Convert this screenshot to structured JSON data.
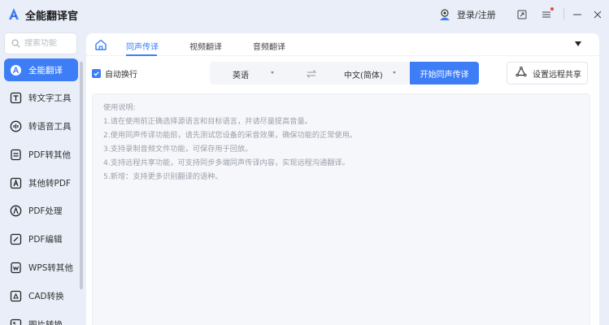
{
  "app": {
    "title": "全能翻译官",
    "login_label": "登录/注册"
  },
  "titlebar_icons": [
    "expand-icon",
    "menu-icon",
    "minimize-icon",
    "close-icon"
  ],
  "sidebar": {
    "search_placeholder": "搜索功能",
    "items": [
      {
        "label": "全能翻译",
        "icon": "translate-icon",
        "active": true
      },
      {
        "label": "转文字工具",
        "icon": "text-tool-icon",
        "active": false
      },
      {
        "label": "转语音工具",
        "icon": "voice-tool-icon",
        "active": false
      },
      {
        "label": "PDF转其他",
        "icon": "pdf-convert-icon",
        "active": false
      },
      {
        "label": "其他转PDF",
        "icon": "to-pdf-icon",
        "active": false
      },
      {
        "label": "PDF处理",
        "icon": "pdf-process-icon",
        "active": false
      },
      {
        "label": "PDF编辑",
        "icon": "pdf-edit-icon",
        "active": false
      },
      {
        "label": "WPS转其他",
        "icon": "wps-convert-icon",
        "active": false
      },
      {
        "label": "CAD转换",
        "icon": "cad-convert-icon",
        "active": false
      },
      {
        "label": "图片转换",
        "icon": "image-convert-icon",
        "active": false
      }
    ]
  },
  "tabs": [
    {
      "label": "同声传译",
      "active": true
    },
    {
      "label": "视频翻译",
      "active": false
    },
    {
      "label": "音频翻译",
      "active": false
    }
  ],
  "toolbar": {
    "auto_wrap_label": "自动换行",
    "auto_wrap_checked": true,
    "source_lang": "英语",
    "target_lang": "中文(简体)",
    "start_label": "开始同声传译",
    "remote_label": "设置远程共享"
  },
  "instructions": {
    "title": "使用说明:",
    "lines": [
      "1.请在使用前正确选择源语言和目标语言，并请尽量提高音量。",
      "2.使用同声传译功能前，请先测试您设备的采音效果，确保功能的正常使用。",
      "3.支持录制音频文件功能，可保存用于回放。",
      "4.支持远程共享功能，可支持同步多端同声传译内容，实现远程沟通翻译。",
      "5.新增：支持更多识别翻译的语种。"
    ]
  },
  "colors": {
    "accent": "#3d7ef7",
    "background": "#e9eef8"
  }
}
